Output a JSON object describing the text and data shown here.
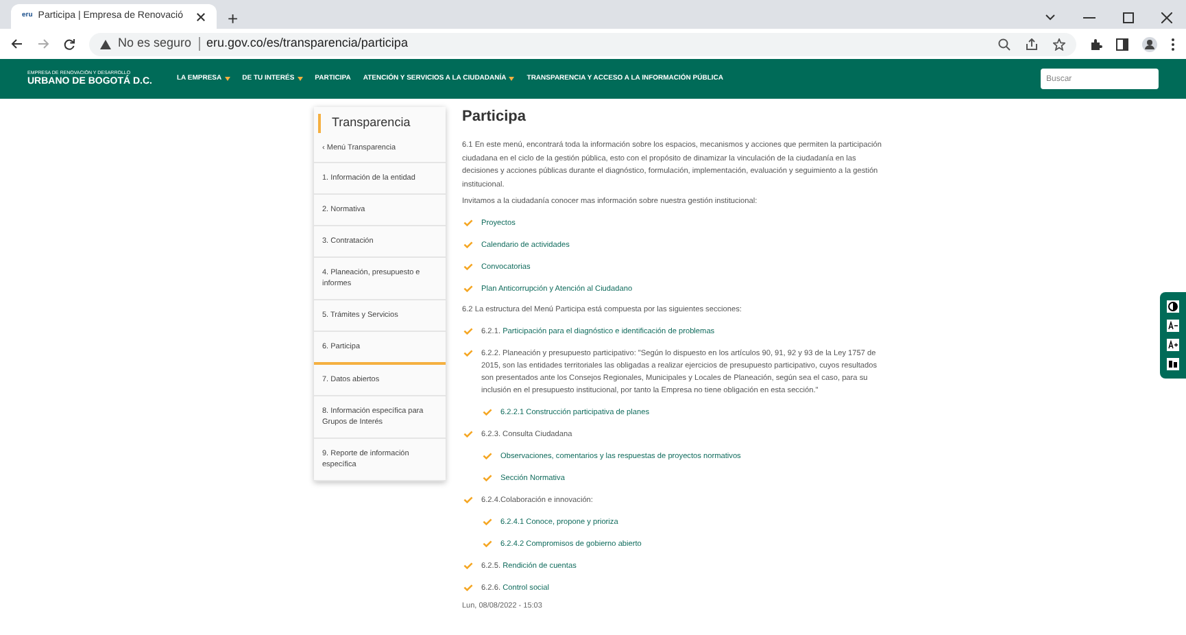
{
  "browser": {
    "tab_title": "Participa | Empresa de Renovació",
    "tab_favicon": "eru",
    "new_tab": "+",
    "security": "No es seguro",
    "url": "eru.gov.co/es/transparencia/participa"
  },
  "site_nav": {
    "logo_small": "EMPRESA DE RENOVACIÓN Y DESARROLLO",
    "logo_big": "URBANO DE BOGOTÁ D.C.",
    "items": [
      {
        "label": "LA EMPRESA",
        "dropdown": true
      },
      {
        "label": "DE TU INTERÉS",
        "dropdown": true
      },
      {
        "label": "PARTICIPA",
        "dropdown": false
      },
      {
        "label": "ATENCIÓN Y SERVICIOS A LA CIUDADANÍA",
        "dropdown": true
      },
      {
        "label": "TRANSPARENCIA Y ACCESO A LA INFORMACIÓN PÚBLICA",
        "dropdown": false
      }
    ],
    "search_placeholder": "Buscar"
  },
  "sidebar": {
    "title": "Transparencia",
    "back": "‹ Menú Transparencia",
    "items": [
      {
        "label": "1. Información de la entidad",
        "selected": false
      },
      {
        "label": "2. Normativa",
        "selected": false
      },
      {
        "label": "3. Contratación",
        "selected": false
      },
      {
        "label": "4. Planeación, presupuesto e informes",
        "selected": false
      },
      {
        "label": "5. Trámites y Servicios",
        "selected": false
      },
      {
        "label": "6. Participa",
        "selected": true
      },
      {
        "label": "7. Datos abiertos",
        "selected": false
      },
      {
        "label": "8. Información específica para Grupos de Interés",
        "selected": false
      },
      {
        "label": "9. Reporte de información específica",
        "selected": false
      }
    ]
  },
  "content": {
    "title": "Participa",
    "blocks": [
      {
        "kind": "paragraph",
        "text": "6.1 En este menú, encontrará toda la información sobre los espacios, mecanismos y acciones que permiten la participación ciudadana en el ciclo de la gestión pública, esto con el propósito de dinamizar la vinculación de la ciudadanía en las decisiones y acciones públicas durante el diagnóstico, formulación, implementación, evaluación y seguimiento a la gestión institucional."
      },
      {
        "kind": "paragraph",
        "text": "Invitamos a la ciudadanía  conocer mas información sobre nuestra gestión institucional:"
      },
      {
        "kind": "list",
        "items": [
          {
            "link": "Proyectos"
          },
          {
            "link": "Calendario de actividades"
          },
          {
            "link": "Convocatorias"
          },
          {
            "link": "Plan Anticorrupción y Atención al Ciudadano"
          }
        ]
      },
      {
        "kind": "paragraph",
        "text": "6.2 La estructura del Menú Participa está compuesta por las siguientes secciones:"
      },
      {
        "kind": "list",
        "items": [
          {
            "prefix": "6.2.1.",
            "link": "Participación para el diagnóstico e identificación de problemas"
          },
          {
            "prefix": "6.2.2. Planeación y presupuesto participativo: \"Según lo dispuesto en los artículos 90, 91, 92 y 93 de la Ley 1757 de 2015, son las entidades territoriales las obligadas a realizar ejercicios de presupuesto participativo, cuyos resultados son presentados ante los Consejos Regionales, Municipales y Locales de Planeación, según sea el caso, para su inclusión en el presupuesto institucional, por tanto la Empresa no tiene obligación en esta sección.\"",
            "children": [
              {
                "link": "6.2.2.1 Construcción participativa de planes"
              }
            ]
          },
          {
            "prefix": "6.2.3. Consulta Ciudadana",
            "children": [
              {
                "link": "Observaciones, comentarios y las respuestas de proyectos normativos"
              },
              {
                "link": "Sección Normativa"
              }
            ]
          },
          {
            "prefix": "6.2.4.Colaboración e innovación:",
            "children": [
              {
                "link": "6.2.4.1 Conoce, propone y prioriza"
              },
              {
                "link": "6.2.4.2 Compromisos de gobierno abierto"
              }
            ]
          },
          {
            "prefix": "6.2.5.",
            "link": "Rendición de cuentas"
          },
          {
            "prefix": "6.2.6.",
            "link": "Control social"
          }
        ]
      }
    ],
    "date": "Lun, 08/08/2022 - 15:03"
  }
}
